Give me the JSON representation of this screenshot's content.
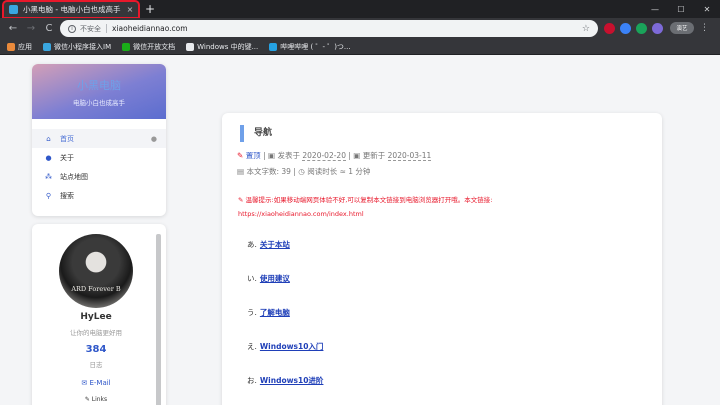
{
  "browser": {
    "tab": {
      "title": "小黑电脑 - 电脑小白也成高手",
      "close": "×"
    },
    "new_tab": "+",
    "window_controls": [
      "—",
      "☐",
      "✕"
    ],
    "nav": {
      "back": "←",
      "forward": "→",
      "reload": "C"
    },
    "address": {
      "security_label": "不安全",
      "url": "xiaoheidiannao.com",
      "info_icon": "i"
    },
    "profile_label": "演艺",
    "menu": "⋮",
    "bookmarks": [
      {
        "label": "应用",
        "icon_color": "#ea8a3b"
      },
      {
        "label": "微信小程序接入IM",
        "icon_color": "#3aa7e0"
      },
      {
        "label": "微信开放文档",
        "icon_color": "#1aad19"
      },
      {
        "label": "Windows 中的键...",
        "icon_color": "#e8eaed"
      },
      {
        "label": "哔哩哔哩 ( ゜- ゜)つ...",
        "icon_color": "#25a2e3"
      }
    ]
  },
  "sidebar": {
    "brand": {
      "title": "小黑电脑",
      "subtitle": "电脑小白也成高手"
    },
    "menu": [
      {
        "label": "首页",
        "icon": "⌂",
        "icon_name": "home-icon",
        "active": true,
        "dot": "●"
      },
      {
        "label": "关于",
        "icon": "●",
        "icon_name": "user-icon",
        "active": false
      },
      {
        "label": "站点地图",
        "icon": "⁂",
        "icon_name": "sitemap-icon",
        "active": false
      },
      {
        "label": "搜索",
        "icon": "⚲",
        "icon_name": "search-icon",
        "active": false
      }
    ]
  },
  "profile": {
    "avatar_text": "ARD Forever B",
    "name": "HyLee",
    "description": "让你的电脑更好用",
    "posts_count": "384",
    "posts_label": "日志",
    "email": "✉ E-Mail",
    "links": "✎ Links"
  },
  "article": {
    "heading": "导航",
    "pinned": "置顶",
    "posted_label": "发表于",
    "posted_date": "2020-02-20",
    "updated_label": "更新于",
    "updated_date": "2020-03-11",
    "wordcount_label": "本文字数:",
    "wordcount": "39",
    "readtime_label": "阅读时长 ≈",
    "readtime": "1 分钟",
    "tip": "温馨提示:如果移动端网页体验不好,可以复制本文链接到电脑浏览器打开哦。本文链接:",
    "tip_url": "https://xiaoheidiannao.com/index.html",
    "toc": [
      {
        "marker": "あ.",
        "label": "关于本站"
      },
      {
        "marker": "い.",
        "label": "使用建议"
      },
      {
        "marker": "う.",
        "label": "了解电脑"
      },
      {
        "marker": "え.",
        "label": "Windows10入门"
      },
      {
        "marker": "お.",
        "label": "Windows10进阶"
      }
    ]
  },
  "colors": {
    "accent": "#2f57c9",
    "warning": "#e8182b",
    "heading_bar": "#6fa0e9"
  }
}
